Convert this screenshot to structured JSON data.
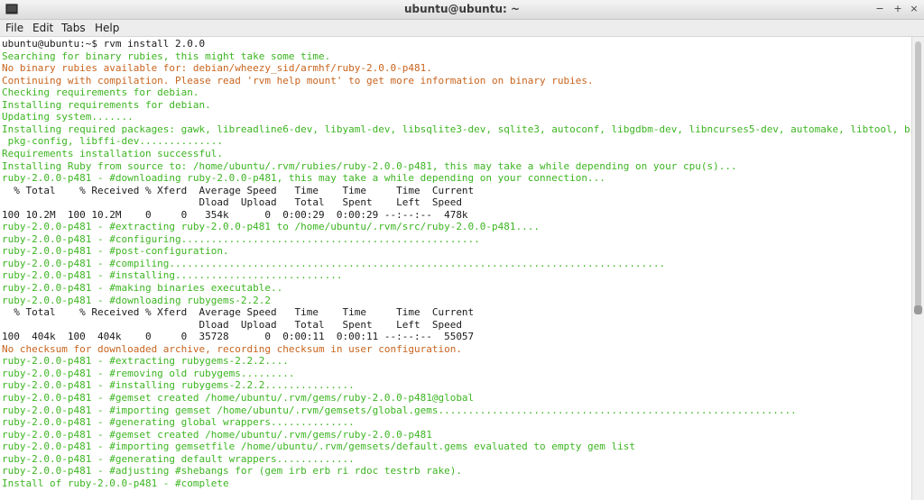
{
  "window": {
    "title": "ubuntu@ubuntu: ~",
    "minimize_glyph": "−",
    "maximize_glyph": "+",
    "close_glyph": "×"
  },
  "menu": {
    "file": "File",
    "edit": "Edit",
    "tabs": "Tabs",
    "help": "Help"
  },
  "colors": {
    "prompt_text": "#1a1a1a",
    "success_text": "#3cb521",
    "warning_text": "#c8641e"
  },
  "terminal": {
    "lines": [
      {
        "text": "ubuntu@ubuntu:~$ rvm install 2.0.0",
        "style": "plain"
      },
      {
        "text": "Searching for binary rubies, this might take some time.",
        "style": "green"
      },
      {
        "text": "No binary rubies available for: debian/wheezy_sid/armhf/ruby-2.0.0-p481.",
        "style": "orange"
      },
      {
        "text": "Continuing with compilation. Please read 'rvm help mount' to get more information on binary rubies.",
        "style": "orange"
      },
      {
        "text": "Checking requirements for debian.",
        "style": "green"
      },
      {
        "text": "Installing requirements for debian.",
        "style": "green"
      },
      {
        "text": "Updating system.......",
        "style": "green"
      },
      {
        "text": "Installing required packages: gawk, libreadline6-dev, libyaml-dev, libsqlite3-dev, sqlite3, autoconf, libgdbm-dev, libncurses5-dev, automake, libtool, bison,",
        "style": "green"
      },
      {
        "text": " pkg-config, libffi-dev..............",
        "style": "green"
      },
      {
        "text": "Requirements installation successful.",
        "style": "green"
      },
      {
        "text": "Installing Ruby from source to: /home/ubuntu/.rvm/rubies/ruby-2.0.0-p481, this may take a while depending on your cpu(s)...",
        "style": "green"
      },
      {
        "text": "ruby-2.0.0-p481 - #downloading ruby-2.0.0-p481, this may take a while depending on your connection...",
        "style": "green"
      },
      {
        "text": "  % Total    % Received % Xferd  Average Speed   Time    Time     Time  Current",
        "style": "plain"
      },
      {
        "text": "                                 Dload  Upload   Total   Spent    Left  Speed",
        "style": "plain"
      },
      {
        "text": "100 10.2M  100 10.2M    0     0   354k      0  0:00:29  0:00:29 --:--:--  478k",
        "style": "plain"
      },
      {
        "text": "ruby-2.0.0-p481 - #extracting ruby-2.0.0-p481 to /home/ubuntu/.rvm/src/ruby-2.0.0-p481....",
        "style": "green"
      },
      {
        "text": "ruby-2.0.0-p481 - #configuring..................................................",
        "style": "green"
      },
      {
        "text": "ruby-2.0.0-p481 - #post-configuration.",
        "style": "green"
      },
      {
        "text": "ruby-2.0.0-p481 - #compiling...................................................................................",
        "style": "green"
      },
      {
        "text": "ruby-2.0.0-p481 - #installing............................",
        "style": "green"
      },
      {
        "text": "ruby-2.0.0-p481 - #making binaries executable..",
        "style": "green"
      },
      {
        "text": "ruby-2.0.0-p481 - #downloading rubygems-2.2.2",
        "style": "green"
      },
      {
        "text": "  % Total    % Received % Xferd  Average Speed   Time    Time     Time  Current",
        "style": "plain"
      },
      {
        "text": "                                 Dload  Upload   Total   Spent    Left  Speed",
        "style": "plain"
      },
      {
        "text": "100  404k  100  404k    0     0  35728      0  0:00:11  0:00:11 --:--:--  55057",
        "style": "plain"
      },
      {
        "text": "No checksum for downloaded archive, recording checksum in user configuration.",
        "style": "orange"
      },
      {
        "text": "ruby-2.0.0-p481 - #extracting rubygems-2.2.2....",
        "style": "green"
      },
      {
        "text": "ruby-2.0.0-p481 - #removing old rubygems.........",
        "style": "green"
      },
      {
        "text": "ruby-2.0.0-p481 - #installing rubygems-2.2.2...............",
        "style": "green"
      },
      {
        "text": "ruby-2.0.0-p481 - #gemset created /home/ubuntu/.rvm/gems/ruby-2.0.0-p481@global",
        "style": "green"
      },
      {
        "text": "ruby-2.0.0-p481 - #importing gemset /home/ubuntu/.rvm/gemsets/global.gems............................................................",
        "style": "green"
      },
      {
        "text": "ruby-2.0.0-p481 - #generating global wrappers..............",
        "style": "green"
      },
      {
        "text": "ruby-2.0.0-p481 - #gemset created /home/ubuntu/.rvm/gems/ruby-2.0.0-p481",
        "style": "green"
      },
      {
        "text": "ruby-2.0.0-p481 - #importing gemsetfile /home/ubuntu/.rvm/gemsets/default.gems evaluated to empty gem list",
        "style": "green"
      },
      {
        "text": "ruby-2.0.0-p481 - #generating default wrappers.............",
        "style": "green"
      },
      {
        "text": "ruby-2.0.0-p481 - #adjusting #shebangs for (gem irb erb ri rdoc testrb rake).",
        "style": "green"
      },
      {
        "text": "Install of ruby-2.0.0-p481 - #complete",
        "style": "green"
      }
    ]
  }
}
